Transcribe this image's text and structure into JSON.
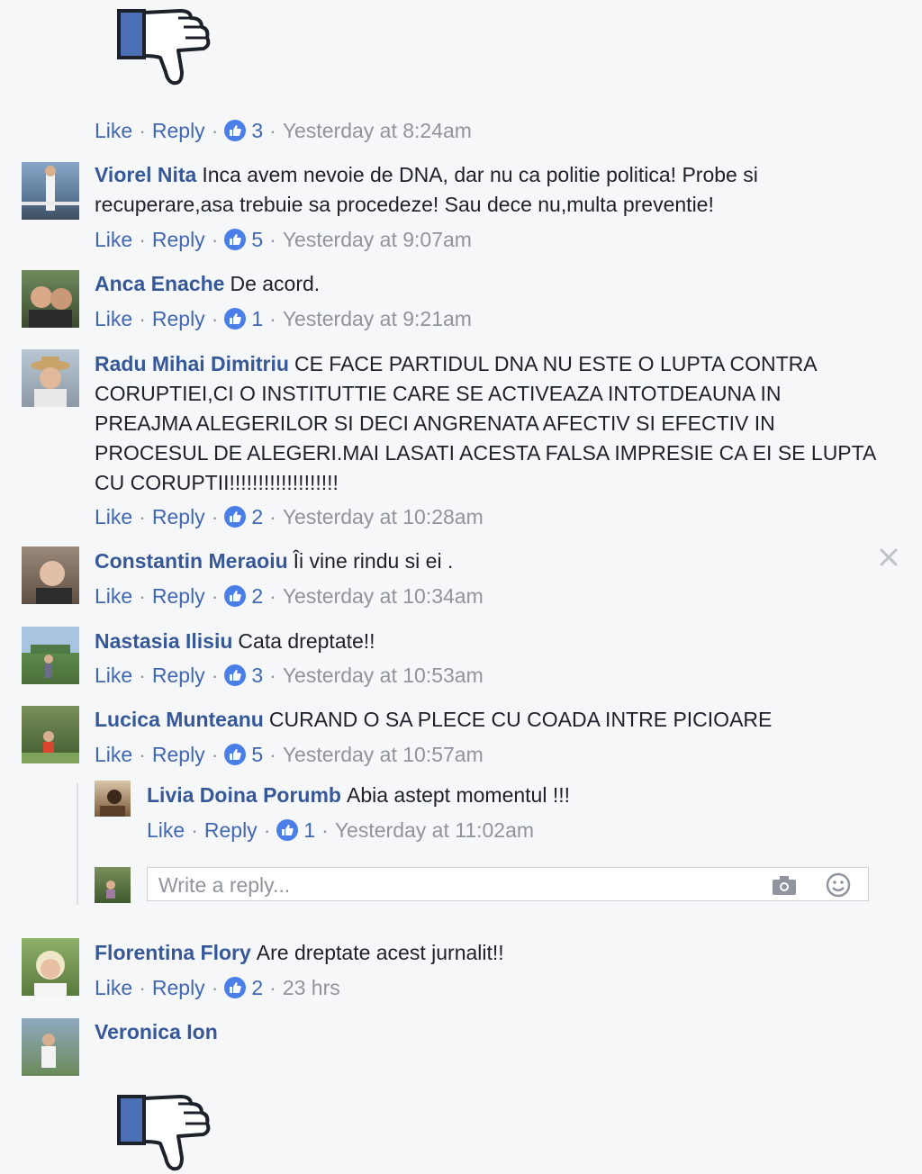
{
  "actions": {
    "like": "Like",
    "reply": "Reply",
    "separator": "·"
  },
  "top_reaction": {
    "count": "3",
    "time": "Yesterday at 8:24am"
  },
  "comments": [
    {
      "author": "Viorel Nita",
      "text": "Inca avem nevoie de DNA, dar nu ca politie politica! Probe si recuperare,asa trebuie sa procedeze! Sau dece nu,multa preventie!",
      "likes": "5",
      "time": "Yesterday at 9:07am"
    },
    {
      "author": "Anca Enache",
      "text": "De acord.",
      "likes": "1",
      "time": "Yesterday at 9:21am"
    },
    {
      "author": "Radu Mihai Dimitriu",
      "text": "CE FACE PARTIDUL DNA NU ESTE O LUPTA CONTRA CORUPTIEI,CI O INSTITUTTIE CARE SE ACTIVEAZA INTOTDEAUNA IN PREAJMA ALEGERILOR SI DECI ANGRENATA AFECTIV SI EFECTIV IN PROCESUL DE ALEGERI.MAI LASATI ACESTA FALSA IMPRESIE CA EI SE LUPTA CU CORUPTII!!!!!!!!!!!!!!!!!!!",
      "likes": "2",
      "time": "Yesterday at 10:28am"
    },
    {
      "author": "Constantin Meraoiu",
      "text": "Îi vine rindu si ei .",
      "likes": "2",
      "time": "Yesterday at 10:34am"
    },
    {
      "author": "Nastasia Ilisiu",
      "text": "Cata dreptate!!",
      "likes": "3",
      "time": "Yesterday at 10:53am"
    },
    {
      "author": "Lucica Munteanu",
      "text": "CURAND O SA PLECE CU COADA INTRE PICIOARE",
      "likes": "5",
      "time": "Yesterday at 10:57am"
    },
    {
      "author": "Florentina Flory",
      "text": "Are dreptate acest jurnalit!!",
      "likes": "2",
      "time": "23 hrs"
    },
    {
      "author": "Veronica Ion",
      "text": ""
    }
  ],
  "reply": {
    "author": "Livia Doina Porumb",
    "text": "Abia astept momentul !!!",
    "likes": "1",
    "time": "Yesterday at 11:02am"
  },
  "reply_box": {
    "placeholder": "Write a reply..."
  },
  "icons": {
    "sticker": "dislike-thumb-icon",
    "camera": "camera-icon",
    "emoji": "emoji-icon",
    "close": "close-icon",
    "like_badge": "like-badge-icon"
  },
  "colors": {
    "link": "#4267b2",
    "name": "#365899",
    "meta": "#90949c",
    "badge": "#4a7ee8",
    "background": "#f6f7f9"
  }
}
